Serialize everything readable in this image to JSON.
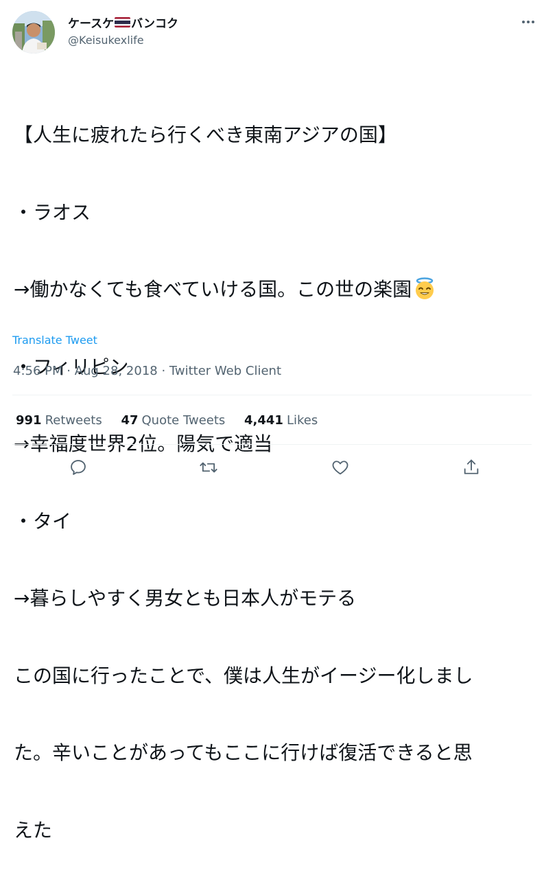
{
  "tweet": {
    "author": {
      "display_name_before_flag": "ケースケ",
      "display_name_after_flag": "バンコク",
      "flag_icon": "thailand-flag",
      "handle": "@Keisukexlife"
    },
    "text_lines": [
      "【人生に疲れたら行くべき東南アジアの国】",
      "・ラオス",
      "→働かなくても食べていける国。この世の楽園",
      "・フィリピン",
      "→幸福度世界2位。陽気で適当",
      "・タイ",
      "→暮らしやすく男女とも日本人がモテる",
      "この国に行ったことで、僕は人生がイージー化しまし",
      "た。辛いことがあってもここに行けば復活できると思",
      "えた"
    ],
    "emoji_after_line_3": "smiling-face-with-halo",
    "translate_label": "Translate Tweet",
    "timestamp": "4:56 PM · Aug 28, 2018 · Twitter Web Client",
    "stats": {
      "retweets_count": "991",
      "retweets_label": "Retweets",
      "quote_count": "47",
      "quote_label": "Quote Tweets",
      "likes_count": "4,441",
      "likes_label": "Likes"
    }
  },
  "icons": {
    "more": "more-dots-icon",
    "reply": "reply-icon",
    "retweet": "retweet-icon",
    "like": "like-icon",
    "share": "share-icon"
  },
  "colors": {
    "text": "#0f1419",
    "secondary": "#536471",
    "link": "#1d9bf0",
    "divider": "#eff3f4"
  }
}
